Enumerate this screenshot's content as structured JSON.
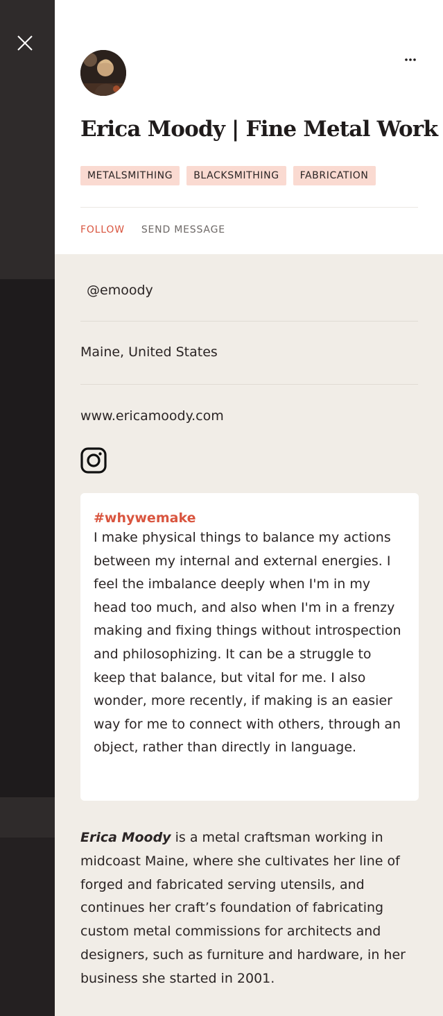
{
  "profile": {
    "title": "Erica Moody | Fine Metal Work",
    "tags": [
      "METALSMITHING",
      "BLACKSMITHING",
      "FABRICATION"
    ],
    "actions": {
      "follow": "FOLLOW",
      "send_message": "SEND MESSAGE"
    },
    "handle": "@emoody",
    "location": "Maine, United States",
    "website": "www.ericamoody.com",
    "more_label": "···"
  },
  "whywemake": {
    "hashtag": "#whywemake",
    "text": "I make physical things to balance my actions between my internal and external energies.  I feel the imbalance deeply when I'm in my head too much, and also when I'm in a frenzy making and fixing things without introspection and philosophizing. It can be a struggle to keep that balance, but vital for me.  I also wonder, more recently, if making is an easier way for me to connect with others, through an object, rather than directly in language."
  },
  "bio": {
    "name": "Erica Moody",
    "text": " is a metal craftsman working in midcoast Maine, where she cultivates her line of forged and fabricated serving utensils, and continues her craft’s foundation of fabricating custom metal commissions for architects and designers, such as furniture and hardware, in her business she started in 2001."
  },
  "icons": {
    "close": "close-icon",
    "more": "more-icon",
    "instagram": "instagram-icon"
  },
  "colors": {
    "accent": "#d9553f",
    "tag_bg": "#fadad1",
    "panel_bg": "#f1ede7"
  }
}
